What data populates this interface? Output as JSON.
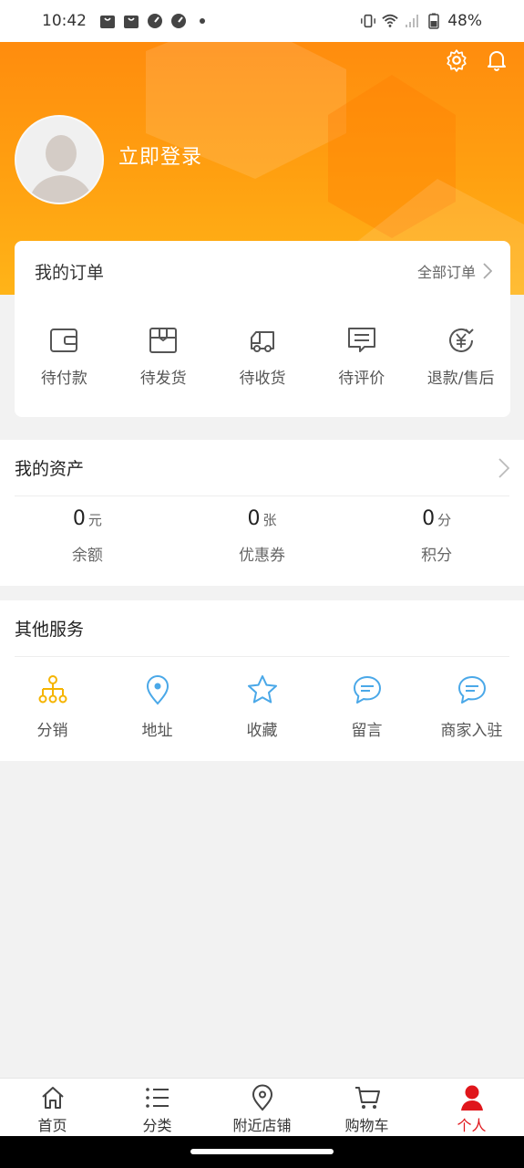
{
  "status_bar": {
    "time": "10:42",
    "battery": "48%",
    "icons": [
      "bag-icon",
      "bag-icon",
      "speed-icon",
      "speed-icon",
      "dot-icon",
      "vibrate-icon",
      "wifi-icon",
      "signal-icon",
      "battery-icon"
    ]
  },
  "header": {
    "login_label": "立即登录",
    "settings_icon": "gear-icon",
    "notification_icon": "bell-icon",
    "accent": "#ff9a10"
  },
  "orders": {
    "title": "我的订单",
    "all_label": "全部订单",
    "items": [
      {
        "label": "待付款",
        "icon": "wallet-icon"
      },
      {
        "label": "待发货",
        "icon": "box-icon"
      },
      {
        "label": "待收货",
        "icon": "truck-icon"
      },
      {
        "label": "待评价",
        "icon": "comment-icon"
      },
      {
        "label": "退款/售后",
        "icon": "refund-icon"
      }
    ]
  },
  "assets": {
    "title": "我的资产",
    "items": [
      {
        "value": "0",
        "unit": "元",
        "label": "余额"
      },
      {
        "value": "0",
        "unit": "张",
        "label": "优惠券"
      },
      {
        "value": "0",
        "unit": "分",
        "label": "积分"
      }
    ]
  },
  "services": {
    "title": "其他服务",
    "items": [
      {
        "label": "分销",
        "icon": "distribution-icon",
        "color": "#f5b400"
      },
      {
        "label": "地址",
        "icon": "location-pin-icon",
        "color": "#4aa8e8"
      },
      {
        "label": "收藏",
        "icon": "star-icon",
        "color": "#4aa8e8"
      },
      {
        "label": "留言",
        "icon": "message-icon",
        "color": "#4aa8e8"
      },
      {
        "label": "商家入驻",
        "icon": "message-icon",
        "color": "#4aa8e8"
      }
    ]
  },
  "tabbar": {
    "items": [
      {
        "label": "首页",
        "icon": "home-icon"
      },
      {
        "label": "分类",
        "icon": "list-icon"
      },
      {
        "label": "附近店铺",
        "icon": "location-pin-icon"
      },
      {
        "label": "购物车",
        "icon": "cart-icon"
      },
      {
        "label": "个人",
        "icon": "person-icon",
        "active": true
      }
    ],
    "active_color": "#e0161b"
  }
}
